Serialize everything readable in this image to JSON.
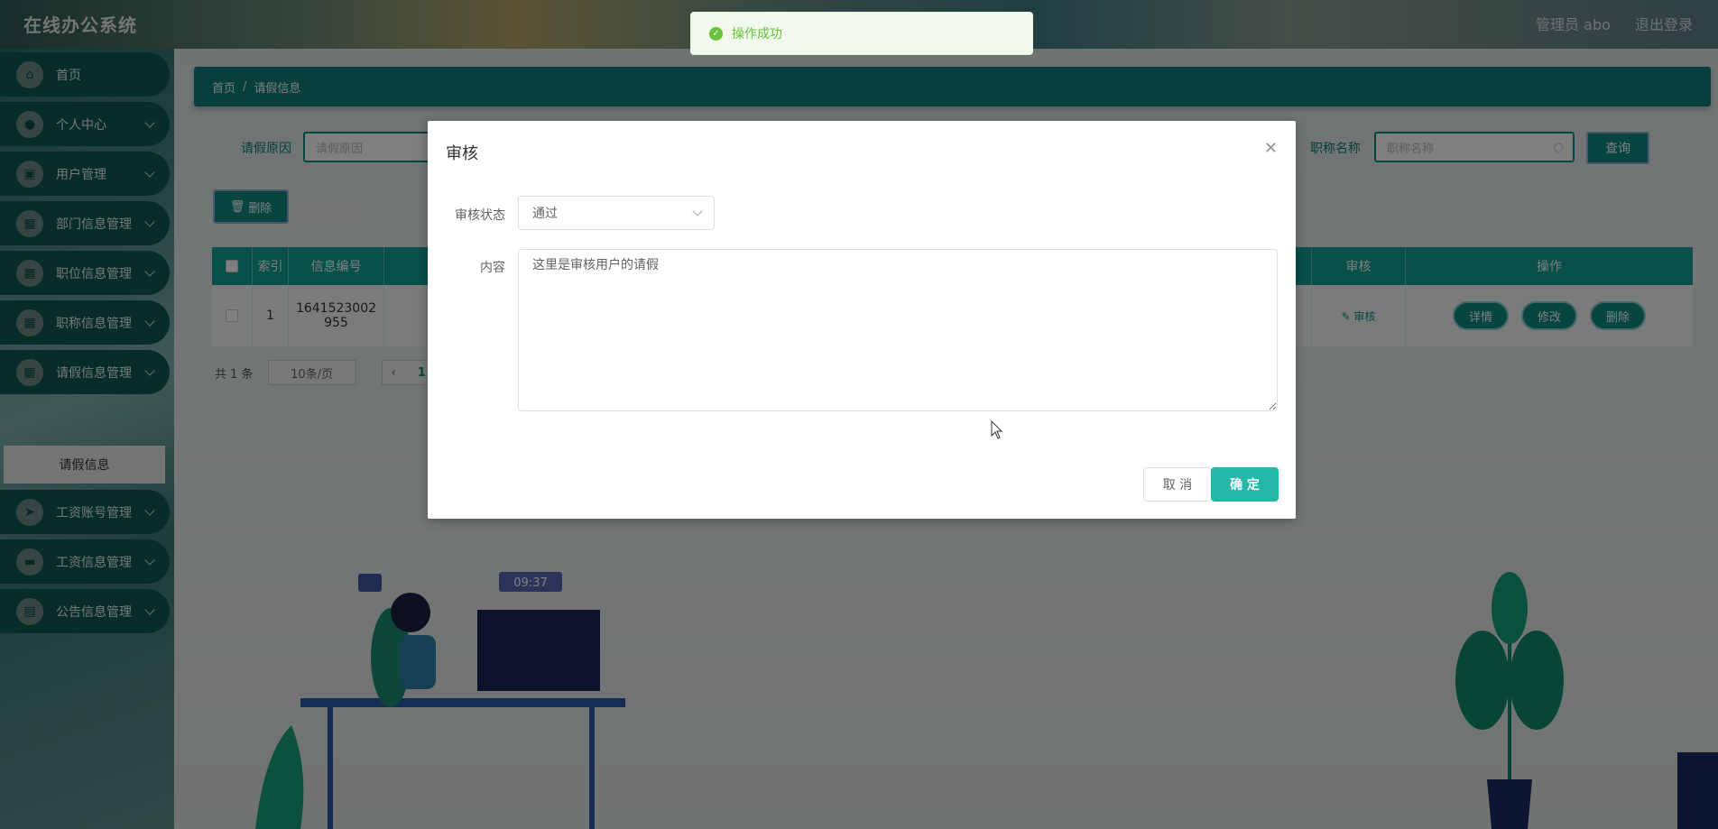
{
  "header": {
    "app_title": "在线办公系统",
    "user_label": "管理员 abo",
    "logout_label": "退出登录"
  },
  "sidebar": {
    "items": [
      {
        "label": "首页",
        "icon": "home-icon"
      },
      {
        "label": "个人中心",
        "icon": "user-icon"
      },
      {
        "label": "用户管理",
        "icon": "briefcase-icon"
      },
      {
        "label": "部门信息管理",
        "icon": "grid-icon"
      },
      {
        "label": "职位信息管理",
        "icon": "grid-icon"
      },
      {
        "label": "职称信息管理",
        "icon": "grid-icon"
      },
      {
        "label": "请假信息管理",
        "icon": "grid-icon"
      },
      {
        "label": "工资账号管理",
        "icon": "send-icon"
      },
      {
        "label": "工资信息管理",
        "icon": "monitor-icon"
      },
      {
        "label": "公告信息管理",
        "icon": "clipboard-icon"
      }
    ],
    "active_sub": "请假信息"
  },
  "breadcrumb": {
    "home": "首页",
    "current": "请假信息"
  },
  "search": {
    "reason_label": "请假原因",
    "reason_placeholder": "请假原因",
    "title_label": "职称名称",
    "title_placeholder": "职称名称",
    "query_label": "查询"
  },
  "toolbar": {
    "delete_label": "删除"
  },
  "table": {
    "headers": {
      "index": "索引",
      "info_no": "信息编号",
      "audit": "审核",
      "ops": "操作"
    },
    "row": {
      "index": "1",
      "info_no_1": "1641523002",
      "info_no_2": "955",
      "audit_link": "审核",
      "detail": "详情",
      "edit": "修改",
      "delete": "删除"
    }
  },
  "pager": {
    "total": "共 1 条",
    "page_size": "10条/页",
    "current_page": "1"
  },
  "illustration": {
    "clock_time": "09:37"
  },
  "dialog": {
    "title": "审核",
    "status_label": "审核状态",
    "status_value": "通过",
    "content_label": "内容",
    "content_value": "这里是审核用户的请假",
    "cancel_label": "取 消",
    "ok_label": "确 定"
  },
  "toast": {
    "message": "操作成功"
  },
  "colors": {
    "primary": "#0e8b83",
    "accent": "#25b8a8",
    "success": "#67c23a"
  }
}
